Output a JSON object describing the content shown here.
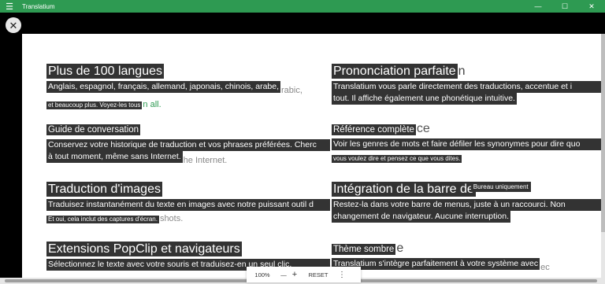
{
  "window": {
    "title": "Translatium",
    "menu_icon": "hamburger-menu-icon",
    "controls": [
      "—",
      "☐",
      "✕"
    ],
    "accent": "#2e9a52"
  },
  "close": "✕",
  "features_left": [
    {
      "title": "Plus de 100 langues",
      "body": "Anglais, espagnol, français, allemand, japonais, chinois, arabe,",
      "body_ghost": "rabic,",
      "small": "et beaucoup plus. Voyez-les tous",
      "small_ghost": "n all."
    },
    {
      "title": "Guide de conversation",
      "body": "Conservez votre historique de traduction et vos phrases préférées. Cherc",
      "small": "à tout moment, même sans Internet.",
      "small_ghost": "he Internet."
    },
    {
      "title": "Traduction d'images",
      "body": "Traduisez instantanément du texte en images avec notre puissant outil d",
      "small": "Et oui, cela inclut des captures d'écran.",
      "small_ghost": "shots."
    },
    {
      "title": "Extensions PopClip et navigateurs",
      "body": "Sélectionnez le texte avec votre souris et traduisez-en un seul clic."
    }
  ],
  "features_right": [
    {
      "title": "Prononciation parfaite",
      "title_ghost": "n",
      "body": "Translatium vous parle directement des traductions, accentue et i",
      "body2": "tout. Il affiche également une phonétique intuitive."
    },
    {
      "title": "Référence complète",
      "title_ghost": "ce",
      "body": "Voir les genres de mots et faire défiler les synonymes pour dire quo",
      "small": "vous voulez dire et pensez ce que vous dites."
    },
    {
      "title": "Intégration de la barre de",
      "badge": "Bureau uniquement",
      "body": "Restez-la dans votre barre de menus, juste à un raccourci. Non",
      "body2": "changement de navigateur. Aucune interruption."
    },
    {
      "title": "Thème sombre",
      "title_ghost": "e",
      "body": "Translatium s'intègre parfaitement à votre système avec",
      "body_ghost": "ec"
    }
  ],
  "zoom": {
    "level": "100%",
    "minus": "—",
    "plus": "+",
    "reset": "RESET",
    "more": "⋮"
  }
}
